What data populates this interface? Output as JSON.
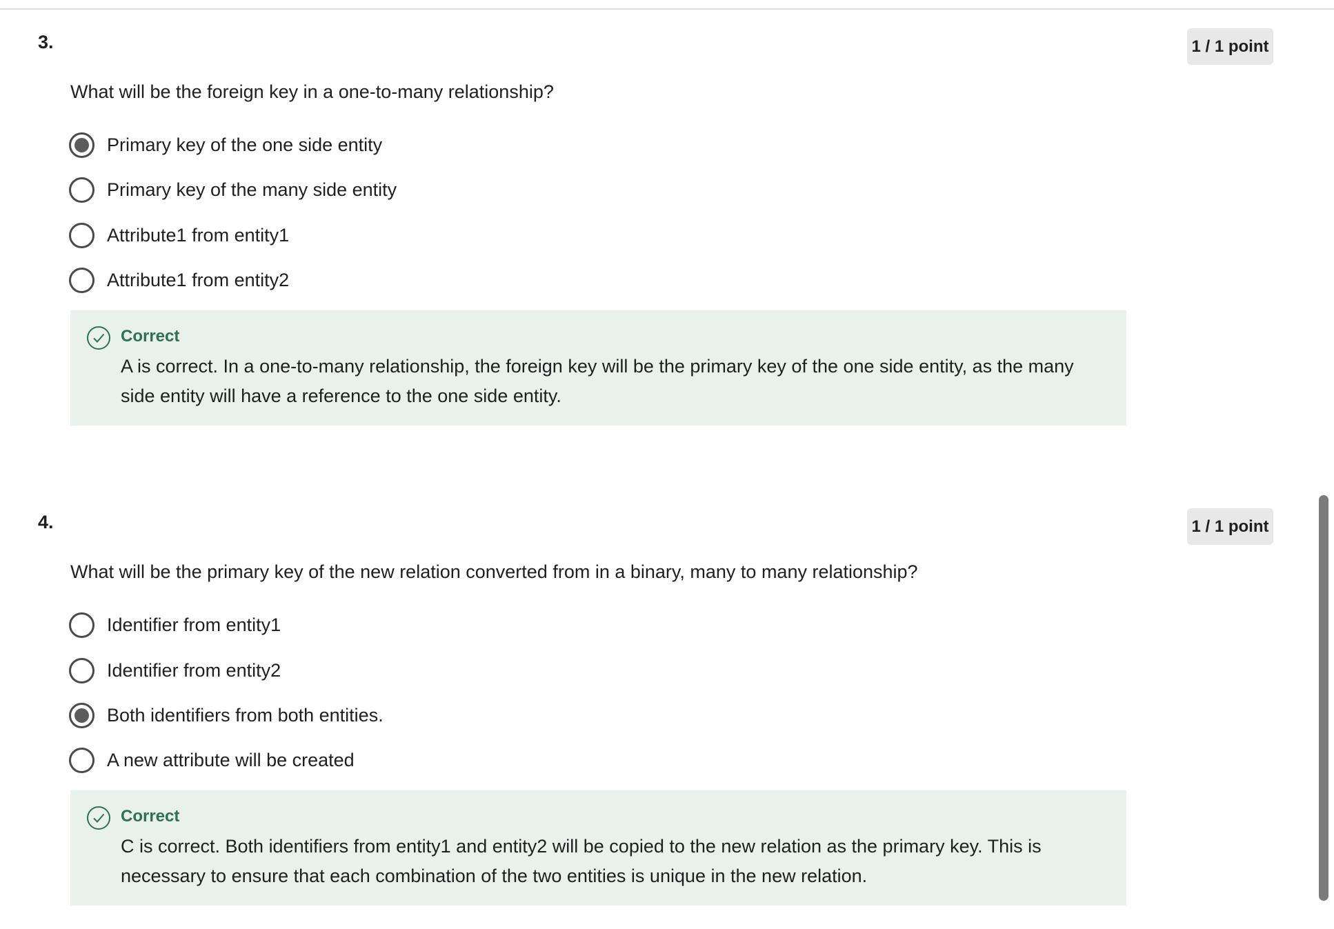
{
  "questions": [
    {
      "number": "3.",
      "points": "1 / 1 point",
      "text": "What will be the foreign key in a one-to-many relationship?",
      "options": [
        {
          "label": "Primary key of the one side entity",
          "selected": true
        },
        {
          "label": "Primary key of the many side entity",
          "selected": false
        },
        {
          "label": "Attribute1 from entity1",
          "selected": false
        },
        {
          "label": "Attribute1 from entity2",
          "selected": false
        }
      ],
      "feedback": {
        "status": "Correct",
        "text": "A is correct. In a one-to-many relationship, the foreign key will be the primary key of the one side entity, as the many side entity will have a reference to the one side entity."
      }
    },
    {
      "number": "4.",
      "points": "1 / 1 point",
      "text": "What will be the primary key of the new relation converted from in a binary, many to many relationship?",
      "options": [
        {
          "label": "Identifier from entity1",
          "selected": false
        },
        {
          "label": "Identifier from entity2",
          "selected": false
        },
        {
          "label": "Both identifiers from both entities.",
          "selected": true
        },
        {
          "label": "A new attribute will be created",
          "selected": false
        }
      ],
      "feedback": {
        "status": "Correct",
        "text": "C is correct. Both identifiers from entity1 and entity2 will be copied to the new relation as the primary key. This is necessary to ensure that each combination of the two entities is unique in the new relation."
      }
    }
  ],
  "colors": {
    "correct_green": "#2e7150",
    "feedback_bg": "#e8f1ec",
    "points_badge_bg": "#e8e8e8"
  },
  "icons": {
    "feedback": "check-circle-icon",
    "selected": "radio-selected-icon",
    "unselected": "radio-unselected-icon"
  }
}
